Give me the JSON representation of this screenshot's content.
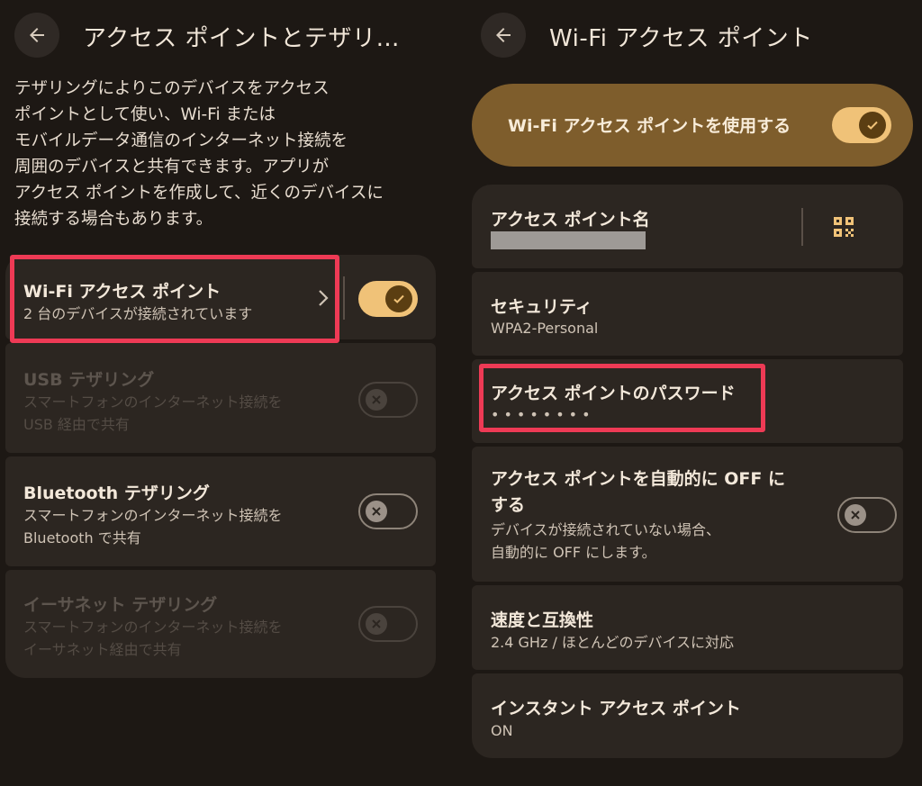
{
  "left": {
    "title": "アクセス ポイントとテザリ…",
    "description": "テザリングによりこのデバイスをアクセス\nポイントとして使い、Wi-Fi または\nモバイルデータ通信のインターネット接続を\n周囲のデバイスと共有できます。アプリが\nアクセス ポイントを作成して、近くのデバイスに\n接続する場合もあります。",
    "rows": [
      {
        "title": "Wi-Fi アクセス ポイント",
        "subtitle": "2 台のデバイスが接続されています",
        "toggle": "on",
        "enabled": true
      },
      {
        "title": "USB テザリング",
        "subtitle": "スマートフォンのインターネット接続を\nUSB 経由で共有",
        "toggle": "off",
        "enabled": false
      },
      {
        "title": "Bluetooth テザリング",
        "subtitle": "スマートフォンのインターネット接続を\nBluetooth で共有",
        "toggle": "off",
        "enabled": true
      },
      {
        "title": "イーサネット テザリング",
        "subtitle": "スマートフォンのインターネット接続を\nイーサネット経由で共有",
        "toggle": "off",
        "enabled": false
      }
    ]
  },
  "right": {
    "title": "Wi-Fi アクセス ポイント",
    "main_switch_label": "Wi-Fi アクセス ポイントを使用する",
    "main_switch_state": "on",
    "rows": [
      {
        "title": "アクセス ポイント名",
        "subtitle": ""
      },
      {
        "title": "セキュリティ",
        "subtitle": "WPA2-Personal"
      },
      {
        "title": "アクセス ポイントのパスワード",
        "subtitle": "••••••••"
      },
      {
        "title": "アクセス ポイントを自動的に OFF に\nする",
        "subtitle": "デバイスが接続されていない場合、\n自動的に OFF にします。",
        "toggle": "off"
      },
      {
        "title": "速度と互換性",
        "subtitle": "2.4 GHz / ほとんどのデバイスに対応"
      },
      {
        "title": "インスタント アクセス ポイント",
        "subtitle": "ON"
      }
    ]
  },
  "icons": {
    "back": "arrow-back-icon",
    "chevron": "chevron-right-icon",
    "qr": "qr-code-icon",
    "check": "check-icon",
    "close": "close-icon"
  },
  "colors": {
    "background": "#1d1814",
    "card": "#2c2621",
    "accent": "#f0c278",
    "hero": "#7e5d2c",
    "highlight": "#ee3a55"
  }
}
